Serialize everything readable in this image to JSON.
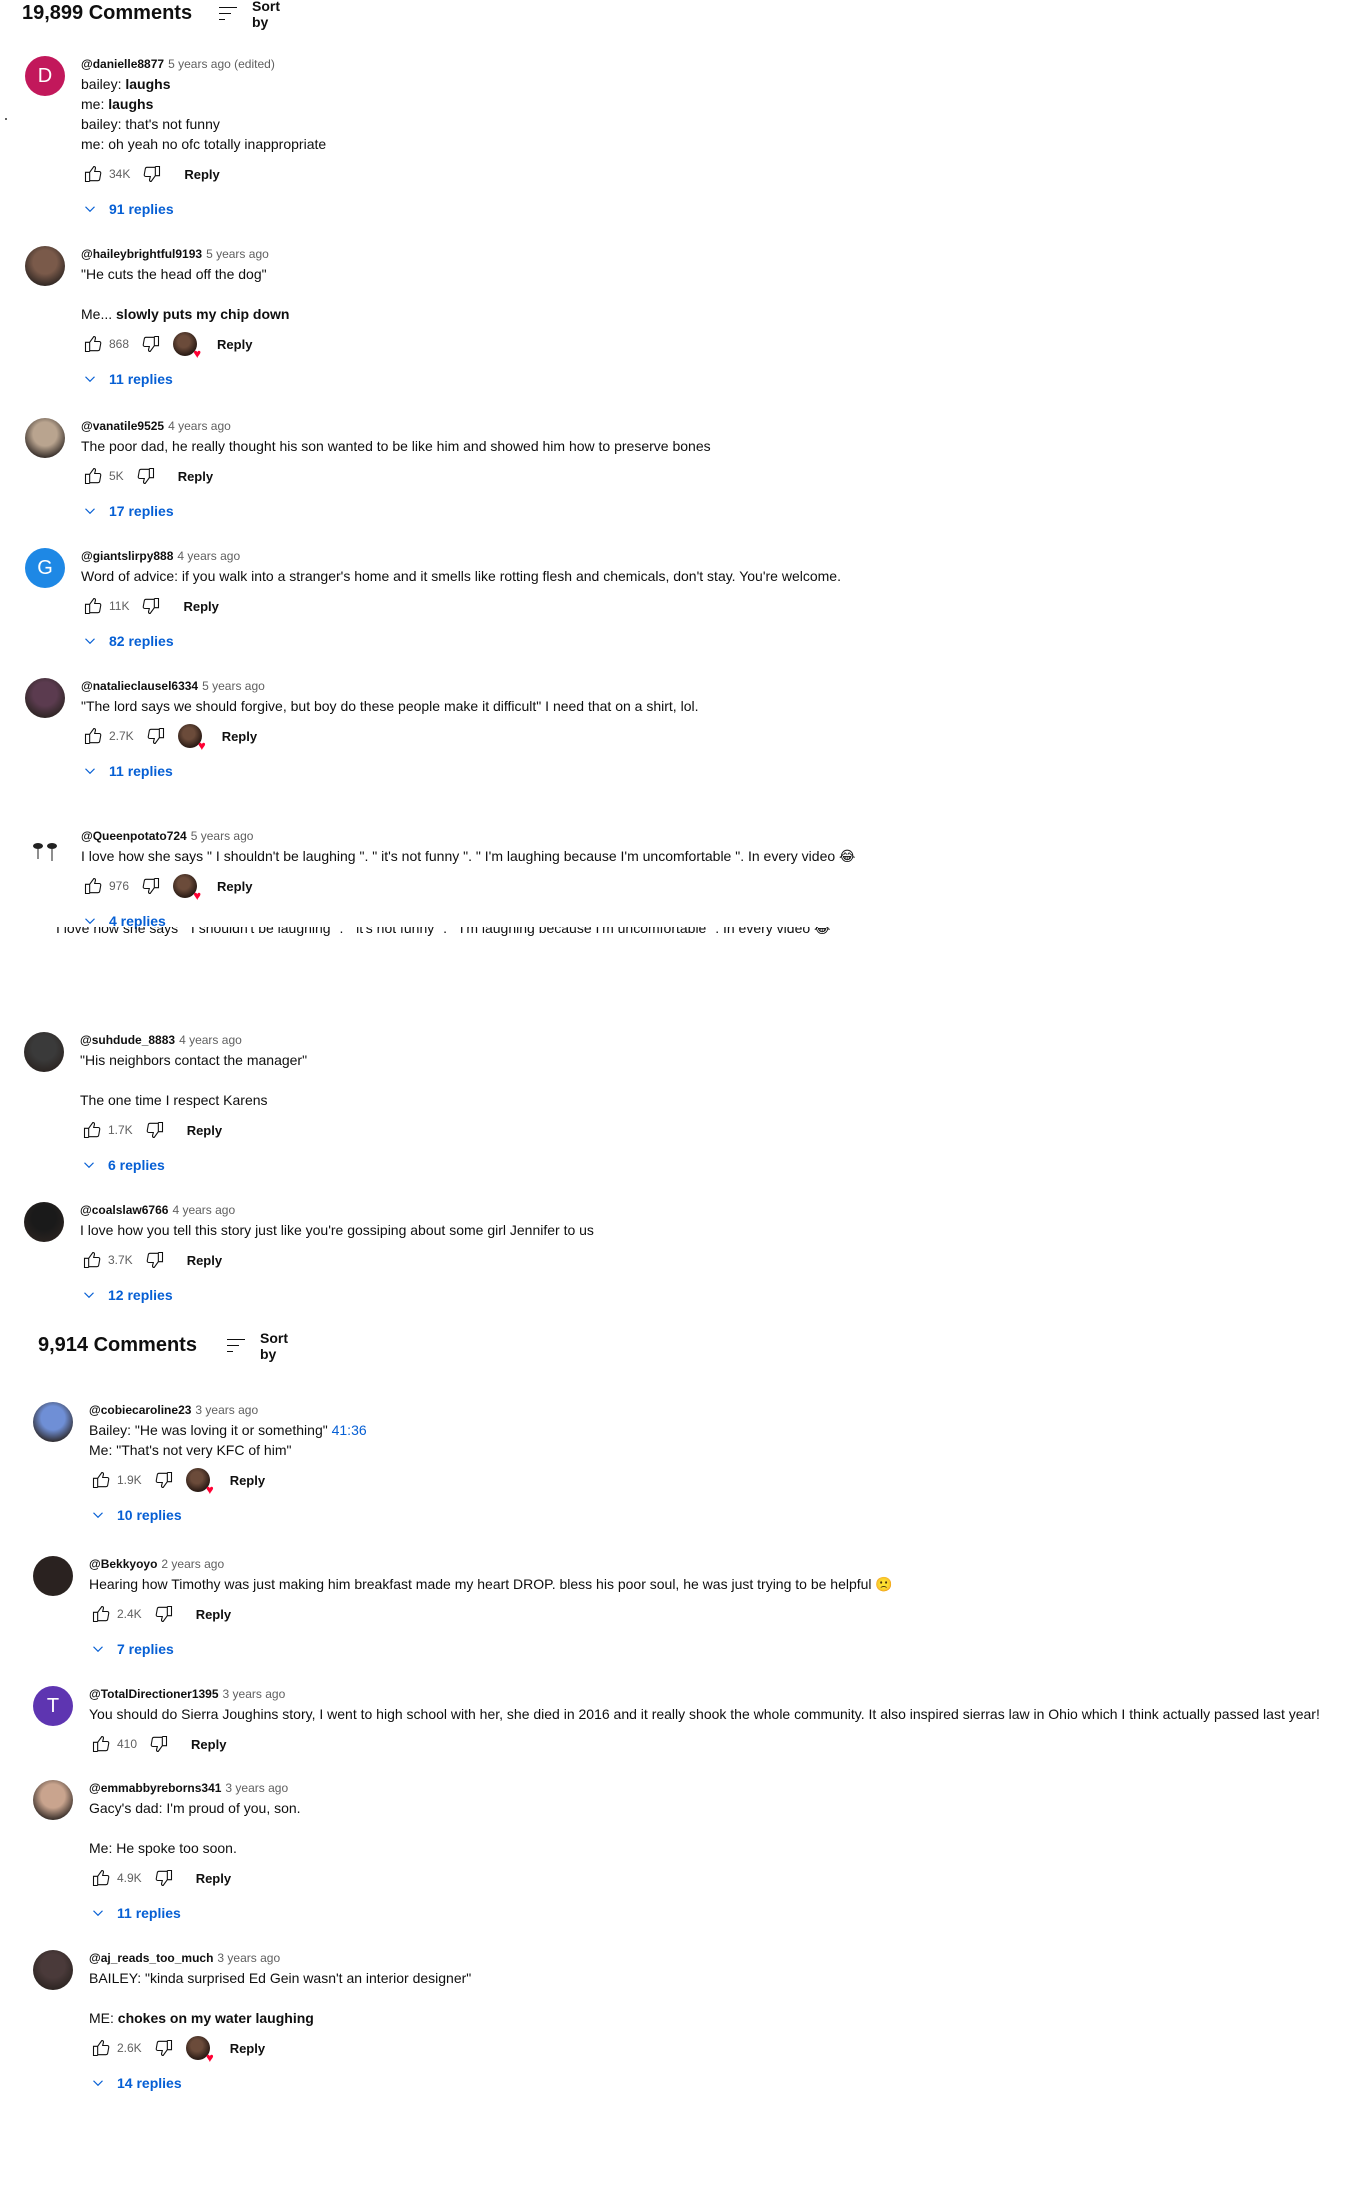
{
  "colors": {
    "link": "#065fd4",
    "meta": "#606060",
    "text": "#0f0f0f"
  },
  "icons": {
    "like": "thumb-up-icon",
    "dislike": "thumb-down-icon",
    "sort": "sort-icon",
    "chevron": "chevron-down-icon",
    "heart": "creator-heart-icon"
  },
  "section1": {
    "count_title": "19,899 Comments",
    "sort_label": "Sort by",
    "comments": [
      {
        "handle": "@danielle8877",
        "time": "5 years ago (edited)",
        "avatar_letter": "D",
        "avatar_color": "#c2185b",
        "lines": [
          {
            "pre": "bailey: ",
            "bold": "laughs"
          },
          {
            "pre": "me: ",
            "bold": "laughs"
          },
          {
            "pre": "bailey: that's not funny"
          },
          {
            "pre": "me: oh yeah no ofc totally inappropriate"
          }
        ],
        "likes": "34K",
        "reply_label": "Reply",
        "replies": "91 replies",
        "hearted": false
      },
      {
        "handle": "@haileybrightful9193",
        "time": "5 years ago",
        "avatar_color": "#7a5a4a",
        "lines": [
          {
            "pre": "\"He cuts the head off the dog\""
          },
          {
            "pre": ""
          },
          {
            "pre": "Me... ",
            "bold": "slowly puts my chip down"
          }
        ],
        "likes": "868",
        "reply_label": "Reply",
        "replies": "11 replies",
        "hearted": true
      },
      {
        "handle": "@vanatile9525",
        "time": "4 years ago",
        "avatar_color": "#b9a48f",
        "lines": [
          {
            "pre": "The poor dad, he really thought his son wanted to be like him and showed him how to preserve bones"
          }
        ],
        "likes": "5K",
        "reply_label": "Reply",
        "replies": "17 replies",
        "hearted": false
      },
      {
        "handle": "@giantslirpy888",
        "time": "4 years ago",
        "avatar_letter": "G",
        "avatar_color": "#1e88e5",
        "lines": [
          {
            "pre": "Word of advice: if you walk into a stranger's home and it smells like rotting flesh and chemicals, don't stay. You're welcome."
          }
        ],
        "likes": "11K",
        "reply_label": "Reply",
        "replies": "82 replies",
        "hearted": false
      },
      {
        "handle": "@natalieclausel6334",
        "time": "5 years ago",
        "avatar_color": "#5b3b4f",
        "lines": [
          {
            "pre": "\"The lord says we should forgive, but boy do these people make it difficult\" I need that on a shirt, lol."
          }
        ],
        "likes": "2.7K",
        "reply_label": "Reply",
        "replies": "11 replies",
        "hearted": true
      },
      {
        "handle": "@Queenpotato724",
        "time": "5 years ago",
        "avatar_color": "#ffffff",
        "lines": [
          {
            "pre": "I love how she says \" I shouldn't be laughing \". \" it's not funny \". \" I'm laughing because I'm uncomfortable \". In every video 😂"
          }
        ],
        "likes": "976",
        "reply_label": "Reply",
        "replies": "4 replies",
        "hearted": true
      },
      {
        "handle": "@suhdude_8883",
        "time": "4 years ago",
        "avatar_color": "#3a3a3a",
        "lines": [
          {
            "pre": "\"His neighbors contact the manager\""
          },
          {
            "pre": ""
          },
          {
            "pre": "The one time I respect Karens"
          }
        ],
        "likes": "1.7K",
        "reply_label": "Reply",
        "replies": "6 replies",
        "hearted": false
      },
      {
        "handle": "@coalslaw6766",
        "time": "4 years ago",
        "avatar_color": "#1a1a1a",
        "lines": [
          {
            "pre": "I love how you tell this story just like you're gossiping about some girl Jennifer to us"
          }
        ],
        "likes": "3.7K",
        "reply_label": "Reply",
        "replies": "12 replies",
        "hearted": false
      }
    ]
  },
  "section2": {
    "count_title": "9,914 Comments",
    "sort_label": "Sort by",
    "comments": [
      {
        "handle": "@cobiecaroline23",
        "time": "3 years ago",
        "avatar_color": "#6f8fd6",
        "lines": [
          {
            "pre": "Bailey: \"He was loving it or something\" ",
            "ts": "41:36"
          },
          {
            "pre": "Me: \"That's not very KFC of him\""
          }
        ],
        "likes": "1.9K",
        "reply_label": "Reply",
        "replies": "10 replies",
        "hearted": true
      },
      {
        "handle": "@Bekkyoyo",
        "time": "2 years ago",
        "avatar_color": "#2a2220",
        "lines": [
          {
            "pre": "Hearing how Timothy was just making him breakfast made my heart DROP. bless his poor soul, he was just trying to be helpful 🙁"
          }
        ],
        "likes": "2.4K",
        "reply_label": "Reply",
        "replies": "7 replies",
        "hearted": false
      },
      {
        "handle": "@TotalDirectioner1395",
        "time": "3 years ago",
        "avatar_letter": "T",
        "avatar_color": "#5e35b1",
        "lines": [
          {
            "pre": "You should do Sierra Joughins story, I went to high school with her, she died in 2016 and it really shook the whole community. It also inspired sierras law in Ohio which I think actually passed last year!"
          }
        ],
        "likes": "410",
        "reply_label": "Reply",
        "replies": "",
        "hearted": false
      },
      {
        "handle": "@emmabbyreborns341",
        "time": "3 years ago",
        "avatar_color": "#c9a48e",
        "lines": [
          {
            "pre": "Gacy's dad: I'm proud of you, son."
          },
          {
            "pre": ""
          },
          {
            "pre": "Me: He spoke too soon."
          }
        ],
        "likes": "4.9K",
        "reply_label": "Reply",
        "replies": "11 replies",
        "hearted": false
      },
      {
        "handle": "@aj_reads_too_much",
        "time": "3 years ago",
        "avatar_color": "#4a3a3a",
        "lines": [
          {
            "pre": "BAILEY: \"kinda surprised Ed Gein wasn't an interior designer\""
          },
          {
            "pre": ""
          },
          {
            "pre": "ME: ",
            "bold": "chokes on my water laughing"
          }
        ],
        "likes": "2.6K",
        "reply_label": "Reply",
        "replies": "14 replies",
        "hearted": true
      }
    ]
  }
}
